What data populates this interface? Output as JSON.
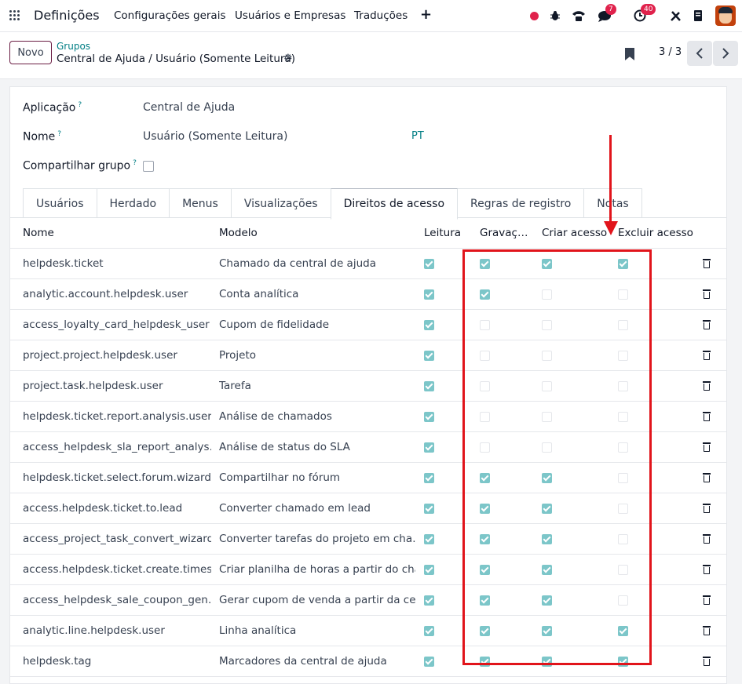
{
  "topbar": {
    "app_title": "Definições",
    "menu": [
      "Configurações gerais",
      "Usuários e Empresas",
      "Traduções"
    ],
    "plus": "+",
    "chat_badge": "7",
    "activity_badge": "40"
  },
  "control": {
    "new_button": "Novo",
    "breadcrumb_parent": "Grupos",
    "breadcrumb_current": "Central de Ajuda / Usuário (Somente Leitura)",
    "pager": "3 / 3"
  },
  "form": {
    "application_label": "Aplicação",
    "application_value": "Central de Ajuda",
    "name_label": "Nome",
    "name_value": "Usuário (Somente Leitura)",
    "lang": "PT",
    "share_label": "Compartilhar grupo",
    "help_mark": "?"
  },
  "tabs": [
    "Usuários",
    "Herdado",
    "Menus",
    "Visualizações",
    "Direitos de acesso",
    "Regras de registro",
    "Notas"
  ],
  "active_tab": 4,
  "table": {
    "headers": [
      "Nome",
      "Modelo",
      "Leitura",
      "Gravaç…",
      "Criar acesso",
      "Excluir acesso"
    ],
    "rows": [
      {
        "name": "helpdesk.ticket",
        "model": "Chamado da central de ajuda",
        "read": true,
        "write": true,
        "create": true,
        "unlink": true
      },
      {
        "name": "analytic.account.helpdesk.user",
        "model": "Conta analítica",
        "read": true,
        "write": true,
        "create": false,
        "unlink": false
      },
      {
        "name": "access_loyalty_card_helpdesk_user",
        "model": "Cupom de fidelidade",
        "read": true,
        "write": false,
        "create": false,
        "unlink": false
      },
      {
        "name": "project.project.helpdesk.user",
        "model": "Projeto",
        "read": true,
        "write": false,
        "create": false,
        "unlink": false
      },
      {
        "name": "project.task.helpdesk.user",
        "model": "Tarefa",
        "read": true,
        "write": false,
        "create": false,
        "unlink": false
      },
      {
        "name": "helpdesk.ticket.report.analysis.user",
        "model": "Análise de chamados",
        "read": true,
        "write": false,
        "create": false,
        "unlink": false
      },
      {
        "name": "access_helpdesk_sla_report_analys…",
        "model": "Análise de status do SLA",
        "read": true,
        "write": false,
        "create": false,
        "unlink": false
      },
      {
        "name": "helpdesk.ticket.select.forum.wizard",
        "model": "Compartilhar no fórum",
        "read": true,
        "write": true,
        "create": true,
        "unlink": false
      },
      {
        "name": "access.helpdesk.ticket.to.lead",
        "model": "Converter chamado em lead",
        "read": true,
        "write": true,
        "create": true,
        "unlink": false
      },
      {
        "name": "access_project_task_convert_wizard",
        "model": "Converter tarefas do projeto em cha…",
        "read": true,
        "write": true,
        "create": true,
        "unlink": false
      },
      {
        "name": "access.helpdesk.ticket.create.times…",
        "model": "Criar planilha de horas a partir do cha…",
        "read": true,
        "write": true,
        "create": true,
        "unlink": false
      },
      {
        "name": "access_helpdesk_sale_coupon_gen…",
        "model": "Gerar cupom de venda a partir da cen…",
        "read": true,
        "write": true,
        "create": true,
        "unlink": false
      },
      {
        "name": "analytic.line.helpdesk.user",
        "model": "Linha analítica",
        "read": true,
        "write": true,
        "create": true,
        "unlink": true
      },
      {
        "name": "helpdesk.tag",
        "model": "Marcadores da central de ajuda",
        "read": true,
        "write": true,
        "create": true,
        "unlink": true
      }
    ]
  },
  "colors": {
    "accent": "#017e84",
    "brand": "#6b1d44",
    "checkbox_on": "#7cc6c9",
    "annotation": "#e1141b"
  }
}
